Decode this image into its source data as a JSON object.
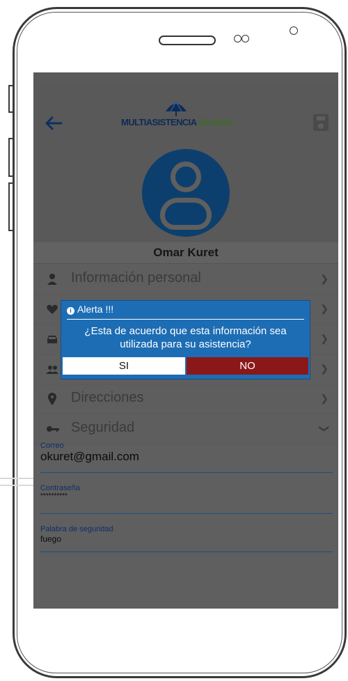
{
  "header": {
    "logo_text_primary": "MULTIASISTENCIA",
    "logo_text_secondary": "GLOBAL",
    "back_icon": "arrow-left-icon",
    "save_icon": "floppy-disk-icon"
  },
  "profile": {
    "name": "Omar Kuret"
  },
  "menu": {
    "items": [
      {
        "label": "Información personal",
        "icon": "person-icon"
      },
      {
        "label": "",
        "icon": "heart-icon"
      },
      {
        "label": "",
        "icon": "car-icon"
      },
      {
        "label": "",
        "icon": "group-icon"
      },
      {
        "label": "Direcciones",
        "icon": "location-pin-icon"
      },
      {
        "label": "Seguridad",
        "icon": "key-icon"
      }
    ]
  },
  "form": {
    "email_label": "Correo",
    "email_value": "okuret@gmail.com",
    "password_label": "Contraseña",
    "password_value": "**********",
    "security_word_label": "Palabra de seguridad",
    "security_word_value": "fuego"
  },
  "dialog": {
    "title": "Alerta !!!",
    "message": "¿Esta de acuerdo que esta información sea utilizada para su asistencia?",
    "yes_label": "SI",
    "no_label": "NO"
  },
  "colors": {
    "primary_blue": "#1d6db4",
    "no_red": "#8b1818",
    "avatar_blue": "#0c3f6d"
  }
}
